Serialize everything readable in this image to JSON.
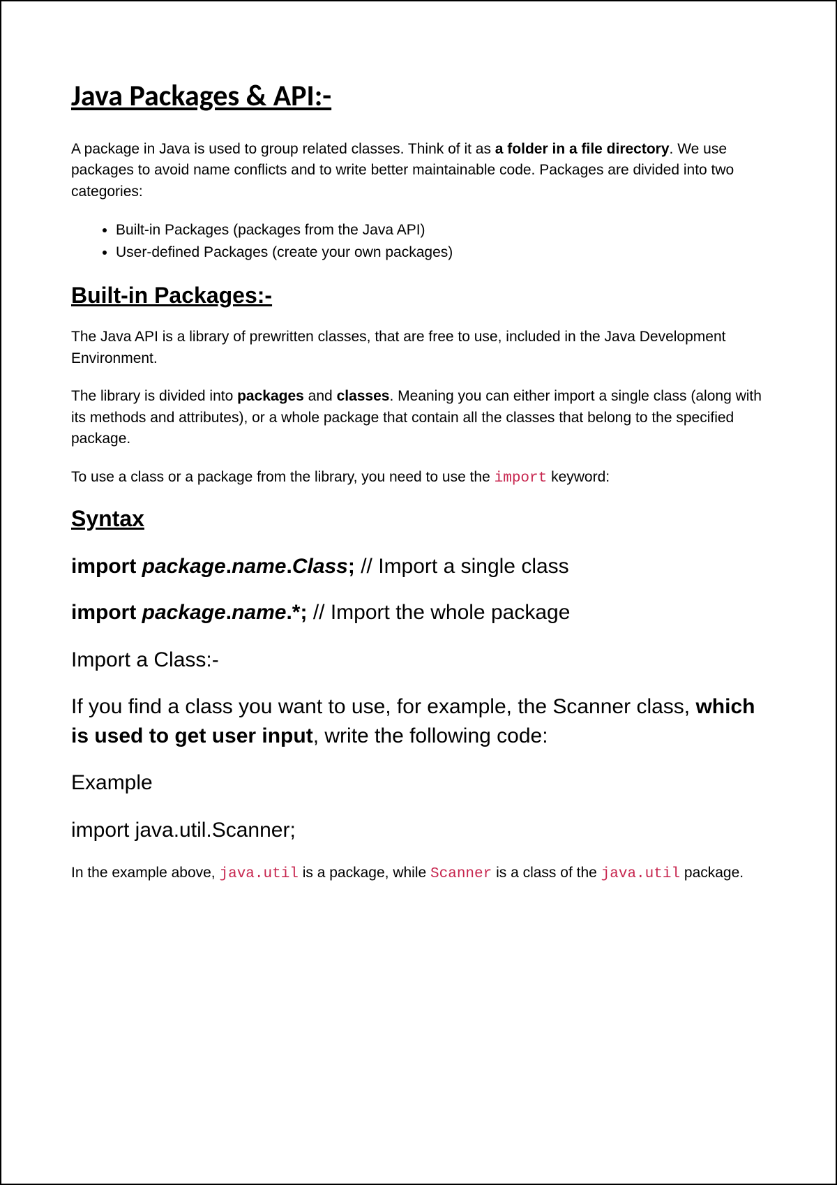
{
  "title": "Java Packages & API:-",
  "intro": {
    "part1": "A package in Java is used to group related classes. Think of it as ",
    "bold": "a folder in a file directory",
    "part2": ". We use packages to avoid name conflicts and to write better maintainable code. Packages are divided into two categories:"
  },
  "categories": [
    "Built-in Packages (packages from the Java API)",
    "User-defined Packages (create your own packages)"
  ],
  "builtin": {
    "heading": "Built-in Packages:-",
    "p1": "The Java API is a library of prewritten classes, that are free to use, included in the Java Development Environment.",
    "p2a": "The library is divided into ",
    "p2b1": "packages",
    "p2mid": " and ",
    "p2b2": "classes",
    "p2c": ". Meaning you can either import a single class (along with its methods and attributes), or a whole package that contain all the classes that belong to the specified package.",
    "p3a": "To use a class or a package from the library, you need to use the ",
    "p3code": "import",
    "p3b": " keyword:"
  },
  "syntax": {
    "heading": "Syntax",
    "line1": {
      "kw": "import ",
      "pkg": "package",
      "dot1": ".",
      "name": "name",
      "dot2": ".",
      "cls": "Class",
      "semi": ";",
      "gap": "   ",
      "slashes": "// ",
      "comment": "Import a single class"
    },
    "line2": {
      "kw": "import ",
      "pkg": "package",
      "dot1": ".",
      "name": "name",
      "dot2": ".*",
      "semi": ";",
      "gap": "   ",
      "slashes": "// ",
      "comment": "Import the whole package"
    }
  },
  "importClass": {
    "heading": "Import a Class:-",
    "p_a": "If you find a class you want to use, for example, the Scanner class, ",
    "p_bold": "which is used to get user input",
    "p_b": ", write the following code:",
    "exampleLabel": "Example",
    "exampleCode": "import java.util.Scanner;",
    "explain_a": "In the example above, ",
    "explain_code1": "java.util",
    "explain_b": " is a package, while ",
    "explain_code2": "Scanner",
    "explain_c": " is a class of the ",
    "explain_code3": "java.util",
    "explain_d": " package."
  }
}
